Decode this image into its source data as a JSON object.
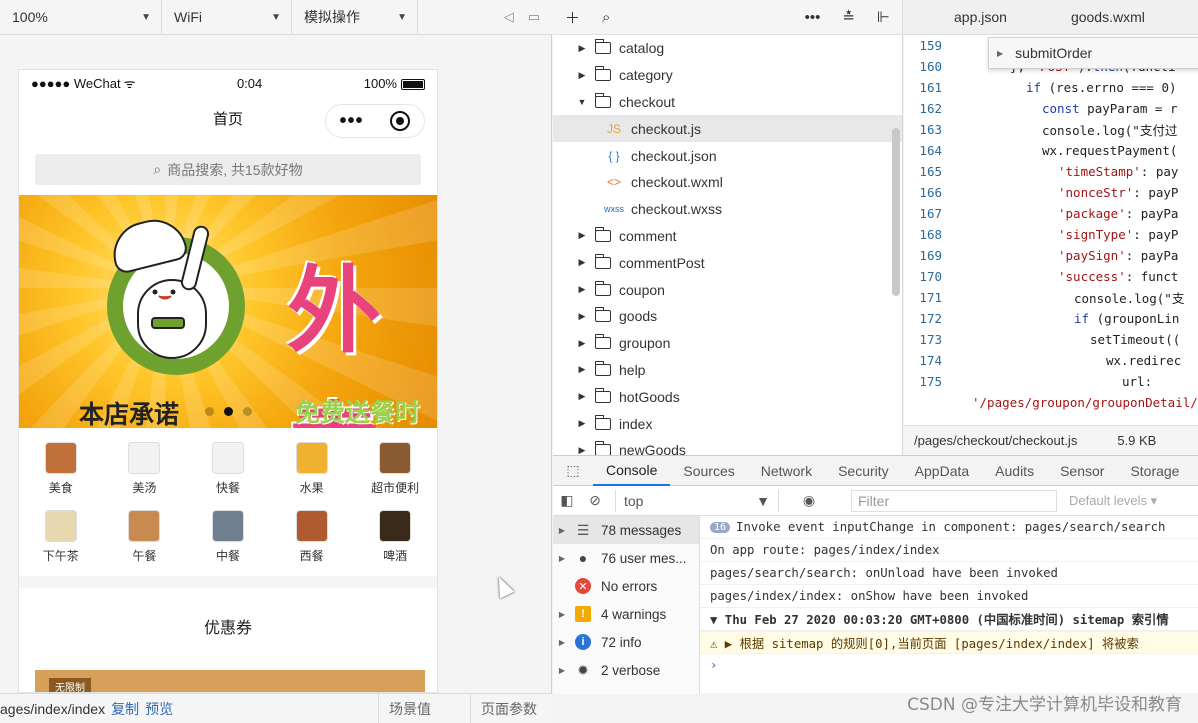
{
  "toolbar": {
    "zoom": "100%",
    "network": "WiFi",
    "mode": "模拟操作"
  },
  "phone": {
    "status": {
      "carrier": "●●●●● WeChat",
      "time": "0:04",
      "battery": "100%"
    },
    "nav_title": "首页",
    "search_placeholder": "商品搜索, 共15款好物",
    "banner": {
      "big_text": "外卖",
      "left_text": "本店承诺",
      "right_text": "免费送餐时"
    },
    "categories": [
      {
        "label": "美食",
        "color": "#c0713a"
      },
      {
        "label": "美汤",
        "color": "#f2f2f2"
      },
      {
        "label": "快餐",
        "color": "#f2f2f2"
      },
      {
        "label": "水果",
        "color": "#f0b030"
      },
      {
        "label": "超市便利",
        "color": "#8a5a30"
      },
      {
        "label": "下午茶",
        "color": "#e8d8b0"
      },
      {
        "label": "午餐",
        "color": "#c98a50"
      },
      {
        "label": "中餐",
        "color": "#6f7f8f"
      },
      {
        "label": "西餐",
        "color": "#b05a30"
      },
      {
        "label": "啤酒",
        "color": "#3a2a1a"
      }
    ],
    "coupon_title": "优惠券",
    "coupon_tag": "无限制"
  },
  "sim_bottom": {
    "path": "ages/index/index",
    "copy": "复制",
    "preview": "预览",
    "scene": "场景值",
    "params": "页面参数"
  },
  "tree": {
    "items": [
      {
        "type": "folder",
        "name": "catalog",
        "open": false
      },
      {
        "type": "folder",
        "name": "category",
        "open": false
      },
      {
        "type": "folder",
        "name": "checkout",
        "open": true
      },
      {
        "type": "js",
        "name": "checkout.js",
        "selected": true
      },
      {
        "type": "json",
        "name": "checkout.json"
      },
      {
        "type": "wxml",
        "name": "checkout.wxml"
      },
      {
        "type": "wxss",
        "name": "checkout.wxss"
      },
      {
        "type": "folder",
        "name": "comment",
        "open": false
      },
      {
        "type": "folder",
        "name": "commentPost",
        "open": false
      },
      {
        "type": "folder",
        "name": "coupon",
        "open": false
      },
      {
        "type": "folder",
        "name": "goods",
        "open": false
      },
      {
        "type": "folder",
        "name": "groupon",
        "open": false
      },
      {
        "type": "folder",
        "name": "help",
        "open": false
      },
      {
        "type": "folder",
        "name": "hotGoods",
        "open": false
      },
      {
        "type": "folder",
        "name": "index",
        "open": false
      },
      {
        "type": "folder",
        "name": "newGoods",
        "open": false
      }
    ]
  },
  "editor": {
    "tabs": [
      "app.json",
      "goods.wxml"
    ],
    "autocomplete": "submitOrder",
    "lines": [
      {
        "n": "159",
        "indent": 0,
        "code": ""
      },
      {
        "n": "160",
        "indent": 6,
        "code": "}, 'POST').then(functi"
      },
      {
        "n": "161",
        "indent": 8,
        "code": "if (res.errno === 0)"
      },
      {
        "n": "162",
        "indent": 10,
        "code": "const payParam = r"
      },
      {
        "n": "163",
        "indent": 10,
        "code": "console.log(\"支付过"
      },
      {
        "n": "164",
        "indent": 10,
        "code": "wx.requestPayment("
      },
      {
        "n": "165",
        "indent": 12,
        "code": "'timeStamp': pay"
      },
      {
        "n": "166",
        "indent": 12,
        "code": "'nonceStr': payP"
      },
      {
        "n": "167",
        "indent": 12,
        "code": "'package': payPa"
      },
      {
        "n": "168",
        "indent": 12,
        "code": "'signType': payP"
      },
      {
        "n": "169",
        "indent": 12,
        "code": "'paySign': payPa"
      },
      {
        "n": "170",
        "indent": 12,
        "code": "'success': funct"
      },
      {
        "n": "171",
        "indent": 14,
        "code": "console.log(\"支"
      },
      {
        "n": "172",
        "indent": 14,
        "code": "if (grouponLin"
      },
      {
        "n": "173",
        "indent": 16,
        "code": "setTimeout(("
      },
      {
        "n": "174",
        "indent": 18,
        "code": "wx.redirec"
      },
      {
        "n": "175",
        "indent": 20,
        "code": "url:"
      },
      {
        "n": "",
        "indent": 0,
        "code": "'/pages/groupon/grouponDetail/"
      }
    ],
    "file_path": "/pages/checkout/checkout.js",
    "file_size": "5.9 KB"
  },
  "devtools": {
    "tabs": [
      "Console",
      "Sources",
      "Network",
      "Security",
      "AppData",
      "Audits",
      "Sensor",
      "Storage"
    ],
    "active_tab": "Console",
    "context": "top",
    "filter_placeholder": "Filter",
    "levels": "Default levels ▾",
    "sidebar": [
      {
        "icon": "list-icon",
        "label": "78 messages",
        "selected": true
      },
      {
        "icon": "user-icon",
        "label": "76 user mes..."
      },
      {
        "icon": "error-icon",
        "label": "No errors"
      },
      {
        "icon": "warning-icon",
        "label": "4 warnings"
      },
      {
        "icon": "info-icon",
        "label": "72 info"
      },
      {
        "icon": "bug-icon",
        "label": "2 verbose"
      }
    ],
    "logs": [
      {
        "badge": "16",
        "text": "Invoke event inputChange in component: pages/search/search",
        "kind": "normal"
      },
      {
        "text": "On app route: pages/index/index",
        "kind": "normal"
      },
      {
        "text": "pages/search/search: onUnload have been invoked",
        "kind": "normal"
      },
      {
        "text": "pages/index/index: onShow have been invoked",
        "kind": "normal"
      },
      {
        "text": "▼ Thu Feb 27 2020 00:03:20 GMT+0800 (中国标准时间) sitemap 索引情",
        "kind": "bold"
      },
      {
        "text": "⚠ ▶ 根据 sitemap 的规则[0],当前页面 [pages/index/index] 将被索",
        "kind": "warn"
      }
    ]
  },
  "watermark": "CSDN @专注大学计算机毕设和教育"
}
